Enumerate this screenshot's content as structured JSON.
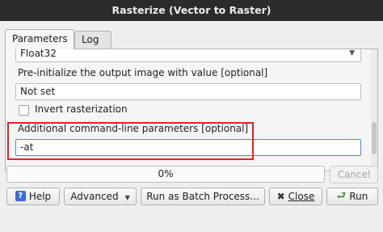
{
  "window": {
    "title": "Rasterize (Vector to Raster)"
  },
  "tabs": [
    {
      "label": "Parameters",
      "active": true
    },
    {
      "label": "Log",
      "active": false
    }
  ],
  "params": {
    "output_type_value": "Float32",
    "init_value_label": "Pre-initialize the output image with value [optional]",
    "init_value": "Not set",
    "invert_label": "Invert rasterization",
    "invert_checked": false,
    "cmdline_label": "Additional command-line parameters [optional]",
    "cmdline_value": "-at"
  },
  "progress": {
    "text": "0%",
    "value": 0
  },
  "buttons": {
    "cancel": "Cancel",
    "help": "Help",
    "advanced": "Advanced",
    "batch": "Run as Batch Process...",
    "close": "Close",
    "run": "Run"
  },
  "icons": {
    "help": "help-icon",
    "close": "close-x-icon",
    "run": "run-arrow-icon",
    "combo": "chevron-down-icon"
  },
  "colors": {
    "highlight": "#e8212b",
    "focus": "#3d8ee6"
  }
}
